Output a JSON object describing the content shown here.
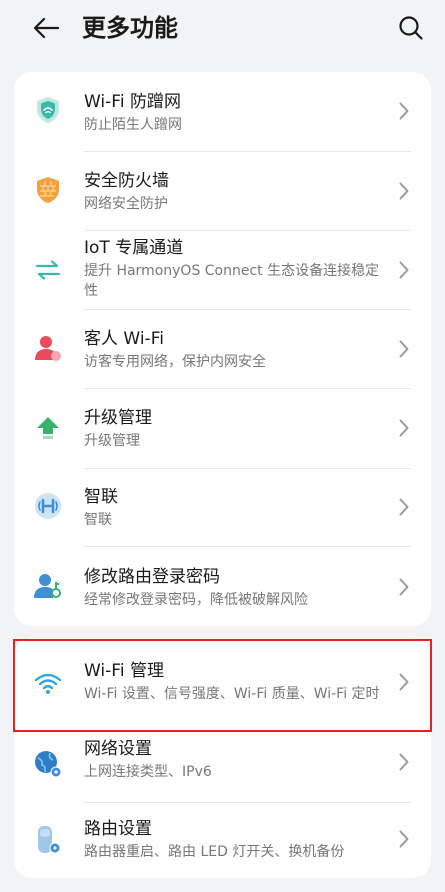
{
  "header": {
    "title": "更多功能",
    "back_icon": "arrow-left-icon",
    "search_icon": "search-icon"
  },
  "colors": {
    "accent_teal": "#3bb8a8",
    "orange": "#f3a03a",
    "red": "#e94b5c",
    "green": "#38b26c",
    "blue": "#3d8fd6",
    "highlight": "#e8201f"
  },
  "card1": {
    "items": [
      {
        "title": "Wi-Fi 防蹭网",
        "subtitle": "防止陌生人蹭网",
        "icon": "shield-icon"
      },
      {
        "title": "安全防火墙",
        "subtitle": "网络安全防护",
        "icon": "firewall-icon"
      },
      {
        "title": "IoT 专属通道",
        "subtitle": "提升 HarmonyOS Connect 生态设备连接稳定性",
        "icon": "iot-arrows-icon"
      },
      {
        "title": "客人 Wi-Fi",
        "subtitle": "访客专用网络，保护内网安全",
        "icon": "guest-user-icon"
      },
      {
        "title": "升级管理",
        "subtitle": "升级管理",
        "icon": "upgrade-arrow-icon"
      },
      {
        "title": "智联",
        "subtitle": "智联",
        "icon": "hilink-icon"
      },
      {
        "title": "修改路由登录密码",
        "subtitle": "经常修改登录密码，降低被破解风险",
        "icon": "user-key-icon"
      }
    ]
  },
  "card2": {
    "items": [
      {
        "title": "Wi-Fi 管理",
        "subtitle": "Wi-Fi 设置、信号强度、Wi-Fi 质量、Wi-Fi 定时",
        "icon": "wifi-icon"
      },
      {
        "title": "网络设置",
        "subtitle": "上网连接类型、IPv6",
        "icon": "globe-settings-icon"
      },
      {
        "title": "路由设置",
        "subtitle": "路由器重启、路由 LED 灯开关、换机备份",
        "icon": "router-settings-icon"
      }
    ]
  }
}
